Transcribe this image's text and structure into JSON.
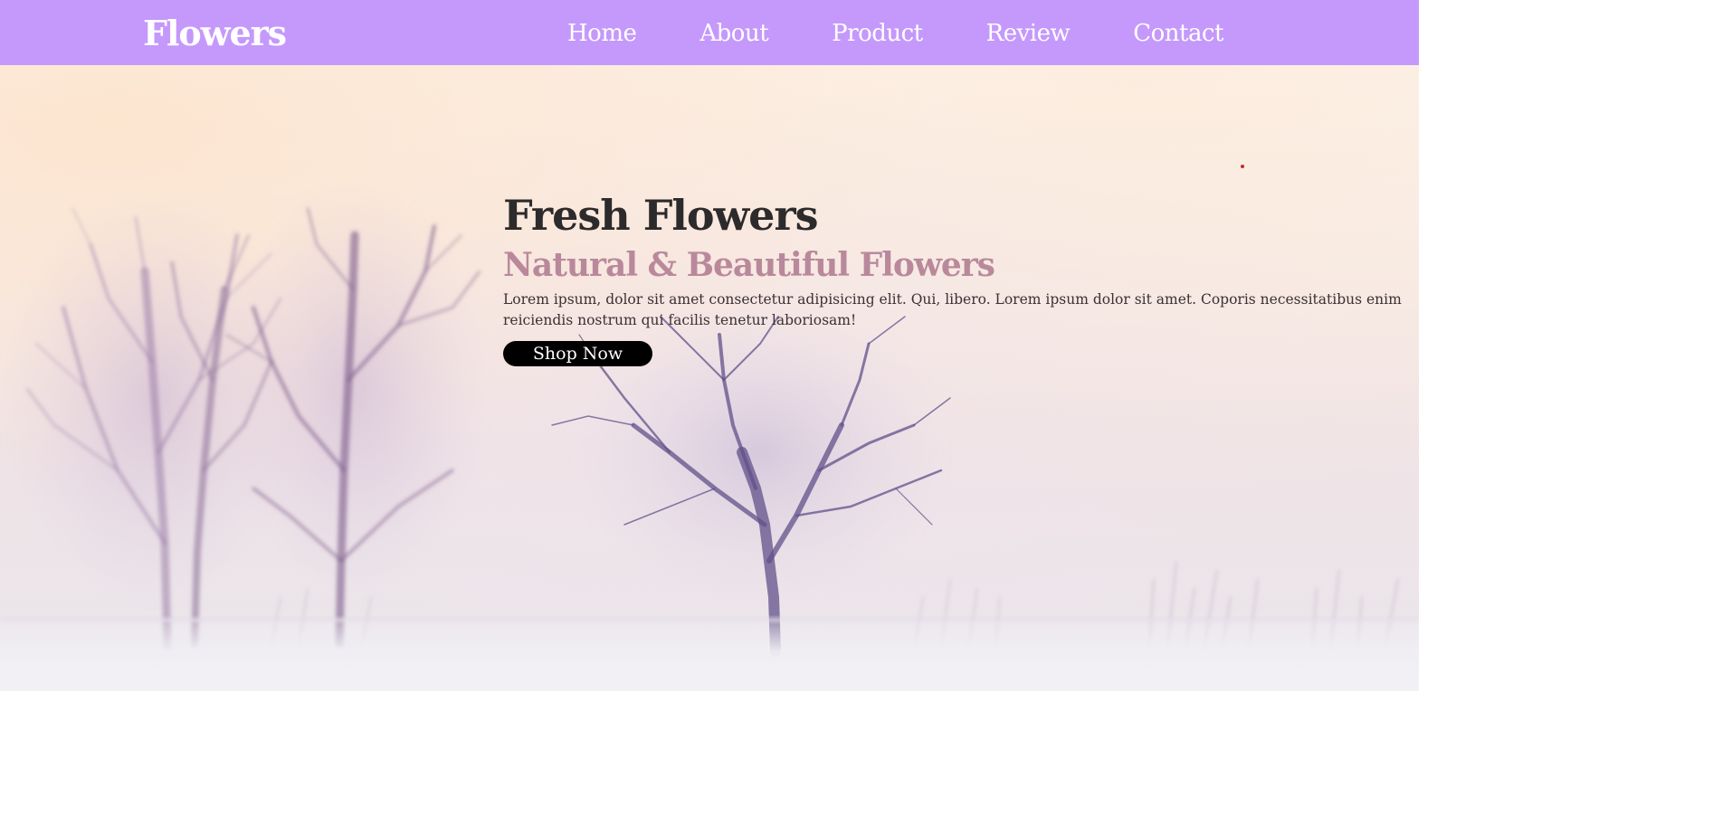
{
  "header": {
    "logo": "Flowers",
    "background_color": "#c499fb",
    "nav": [
      {
        "label": "Home"
      },
      {
        "label": "About"
      },
      {
        "label": "Product"
      },
      {
        "label": "Review"
      },
      {
        "label": "Contact"
      }
    ]
  },
  "hero": {
    "title": "Fresh Flowers",
    "subtitle": "Natural & Beautiful Flowers",
    "description": "Lorem ipsum, dolor sit amet consectetur adipisicing elit. Qui, libero. Lorem ipsum dolor sit amet. Coporis necessitatibus enim reiciendis nostrum qui facilis tenetur laboriosam!",
    "button_label": "Shop Now",
    "title_color": "#2d2a2b",
    "subtitle_color": "#b9899b",
    "button_color": "#000000"
  },
  "background": {
    "scene": "misty-winter-trees"
  }
}
